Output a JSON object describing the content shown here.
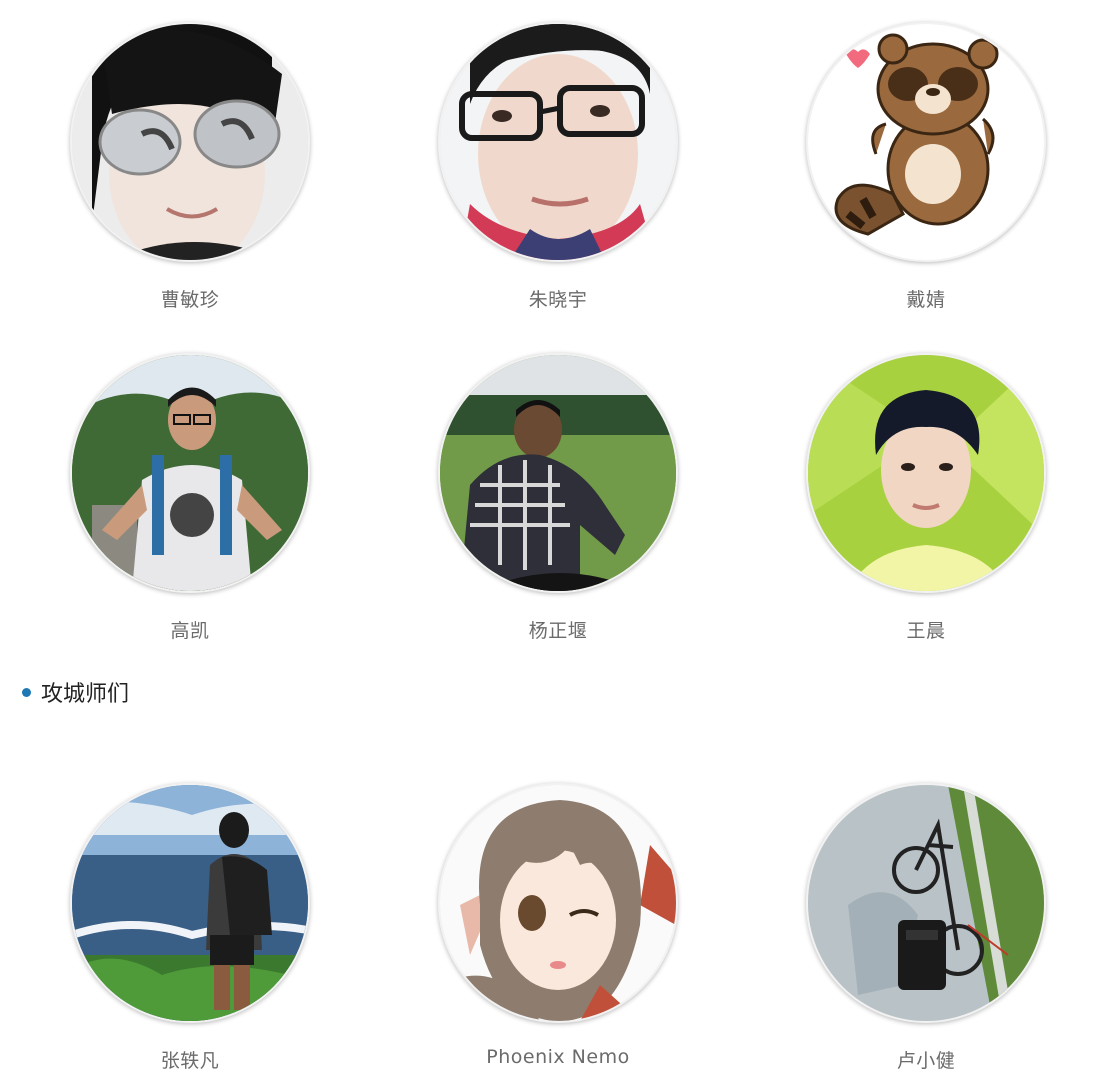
{
  "team_members": [
    {
      "name": "曹敏珍",
      "avatar_icon": "girl-sunglasses-photo"
    },
    {
      "name": "朱晓宇",
      "avatar_icon": "boy-glasses-photo"
    },
    {
      "name": "戴婧",
      "avatar_icon": "raccoon-cartoon"
    },
    {
      "name": "高凯",
      "avatar_icon": "boy-backpack-photo"
    },
    {
      "name": "杨正堰",
      "avatar_icon": "boy-grass-field-photo"
    },
    {
      "name": "王晨",
      "avatar_icon": "boy-green-background-photo"
    }
  ],
  "section": {
    "title": "攻城师们",
    "bullet_color": "#1e78b4"
  },
  "engineers": [
    {
      "name": "张轶凡",
      "avatar_icon": "man-seaside-photo"
    },
    {
      "name": "Phoenix Nemo",
      "avatar_icon": "anime-girl-avatar"
    },
    {
      "name": "卢小健",
      "avatar_icon": "bicycle-road-photo"
    }
  ]
}
